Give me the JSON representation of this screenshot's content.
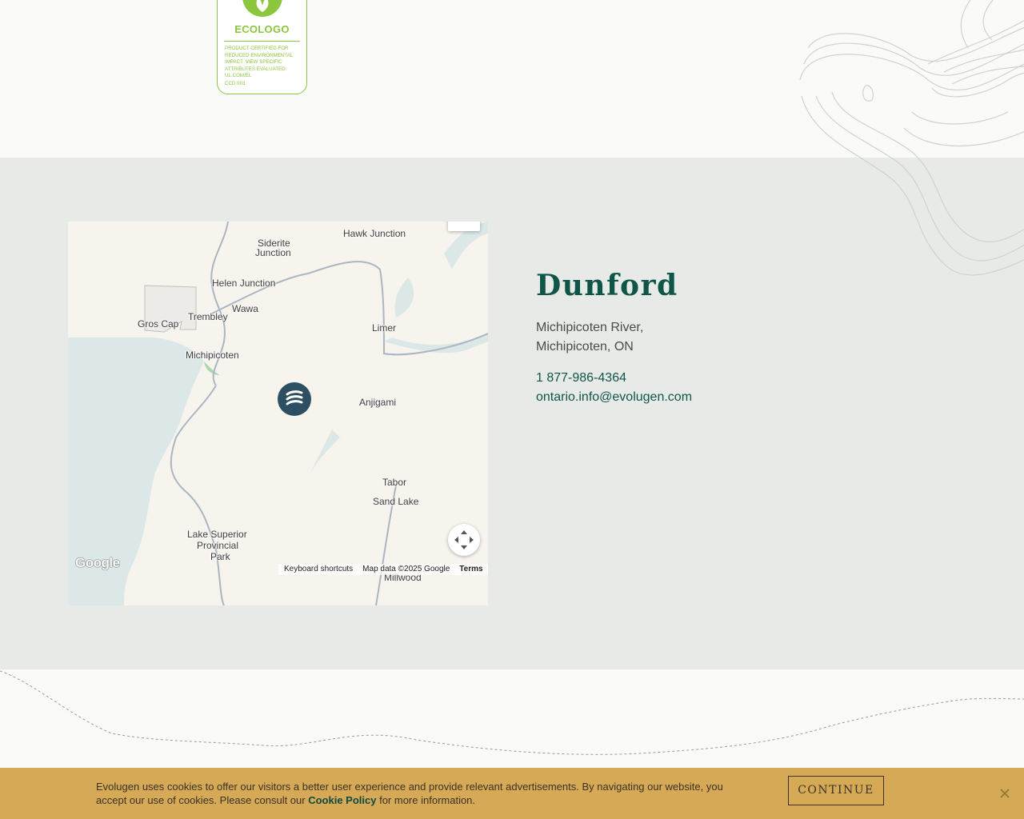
{
  "colors": {
    "brand_green": "#0f5648",
    "ecologo_green": "#8cc63f",
    "cookie_bar": "#d5a955",
    "marker": "#2c4f62",
    "water": "#dce8e8"
  },
  "ecologo": {
    "brand": "ECOLOGO",
    "fine_print": "PRODUCT CERTIFIED FOR REDUCED ENVIRONMENTAL IMPACT. VIEW SPECIFIC ATTRIBUTES EVALUATED: UL.COM/EL",
    "code": "CCD 003",
    "icon": "leaf-icon"
  },
  "map": {
    "places": {
      "hawk_junction": "Hawk Junction",
      "siderite_1": "Siderite",
      "siderite_2": "Junction",
      "helen_junction": "Helen Junction",
      "wawa": "Wawa",
      "trembley": "Trembley",
      "gros_cap": "Gros Cap",
      "michipicoten": "Michipicoten",
      "limer": "Limer",
      "anjigami": "Anjigami",
      "tabor": "Tabor",
      "sand_lake": "Sand Lake",
      "lsp_1": "Lake Superior",
      "lsp_2": "Provincial",
      "lsp_3": "Park",
      "millwood": "Millwood"
    },
    "google_logo": "Google",
    "keyboard_shortcuts": "Keyboard shortcuts",
    "map_data": "Map data ©2025 Google",
    "terms": "Terms",
    "marker_icon": "evolugen-marker-icon",
    "fullscreen_icon": "fullscreen-icon"
  },
  "location": {
    "name": "Dunford",
    "address_line1": "Michipicoten River,",
    "address_line2": "Michipicoten, ON",
    "phone": "1 877-986-4364",
    "email": "ontario.info@evolugen.com"
  },
  "cookie": {
    "text_before": "Evolugen uses cookies to offer our visitors a better user experience and provide relevant advertisements. By navigating our website, you accept our use of cookies. Please consult our",
    "policy_link": "Cookie Policy",
    "text_after": "for more information.",
    "continue_label": "CONTINUE",
    "close_icon": "close-icon"
  }
}
